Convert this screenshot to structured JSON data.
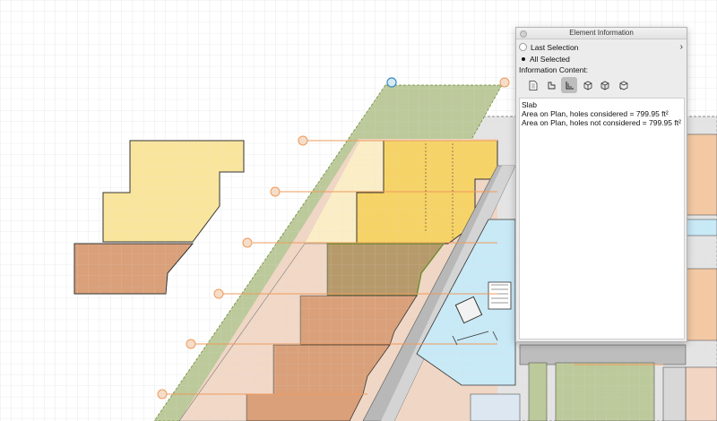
{
  "palette": {
    "title": "Element Information",
    "last_selection_label": "Last Selection",
    "all_selected_label": "All Selected",
    "information_content_label": "Information Content:",
    "icons": [
      "document-icon",
      "slab-outline-icon",
      "area-measure-icon",
      "cube-icon",
      "cube-stack-icon",
      "cube-rotate-icon"
    ],
    "selected_icon_index": 2,
    "info_lines": [
      "Slab",
      "Area on Plan, holes considered = 799.95 ft²",
      "Area on Plan, holes not considered = 799.95 ft²"
    ]
  },
  "colors": {
    "grid": "#dcdcdc",
    "yellow_light": "#fae59d",
    "yellow_dark": "#f6d366",
    "brown": "#d9a07a",
    "tan_light": "#f0d6c4",
    "green": "#bcc99a",
    "cyan": "#c8e9f6",
    "orange_line": "#ee9b5d",
    "gray_wall": "#b8b8b8"
  }
}
